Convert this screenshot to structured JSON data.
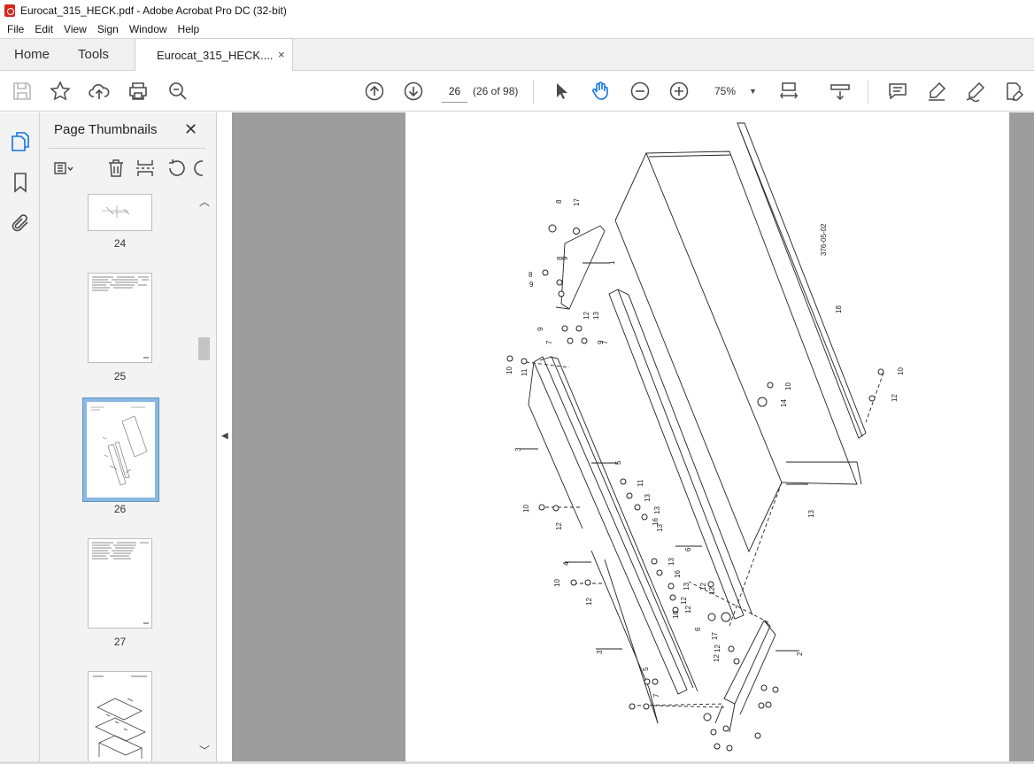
{
  "window": {
    "title": "Eurocat_315_HECK.pdf - Adobe Acrobat Pro DC (32-bit)"
  },
  "menu": [
    "File",
    "Edit",
    "View",
    "Sign",
    "Window",
    "Help"
  ],
  "tabs": {
    "home": "Home",
    "tools": "Tools",
    "document": "Eurocat_315_HECK....",
    "close": "×"
  },
  "toolbar": {
    "page_number": "26",
    "page_count": "(26 of 98)",
    "zoom": "75%",
    "icons": [
      "save-icon",
      "bookmark-star-icon",
      "upload-icon",
      "print-icon",
      "search-zoom-icon",
      "page-up-icon",
      "page-down-icon",
      "select-arrow-icon",
      "hand-icon",
      "zoom-out-icon",
      "zoom-in-icon",
      "fit-page-icon",
      "scroll-mode-icon",
      "comment-icon",
      "highlight-icon",
      "sign-icon",
      "edit-pdf-icon"
    ]
  },
  "sidebar": {
    "title": "Page Thumbnails",
    "close": "✕",
    "thumbnails": [
      {
        "label": "24",
        "selected": false
      },
      {
        "label": "25",
        "selected": false
      },
      {
        "label": "26",
        "selected": true
      },
      {
        "label": "27",
        "selected": false
      }
    ]
  },
  "drawing": {
    "ref_code": "376-05-02",
    "callouts": [
      "1",
      "2",
      "3",
      "3",
      "4",
      "5",
      "5",
      "6",
      "6",
      "7",
      "7",
      "7",
      "8",
      "8",
      "8",
      "9",
      "9",
      "9",
      "9",
      "10",
      "10",
      "10",
      "10",
      "10",
      "10",
      "11",
      "11",
      "12",
      "12",
      "12",
      "12",
      "12",
      "12",
      "12",
      "12",
      "12",
      "12",
      "13",
      "13",
      "13",
      "13",
      "13",
      "13",
      "13",
      "14",
      "15",
      "16",
      "16",
      "17",
      "17",
      "18"
    ]
  }
}
